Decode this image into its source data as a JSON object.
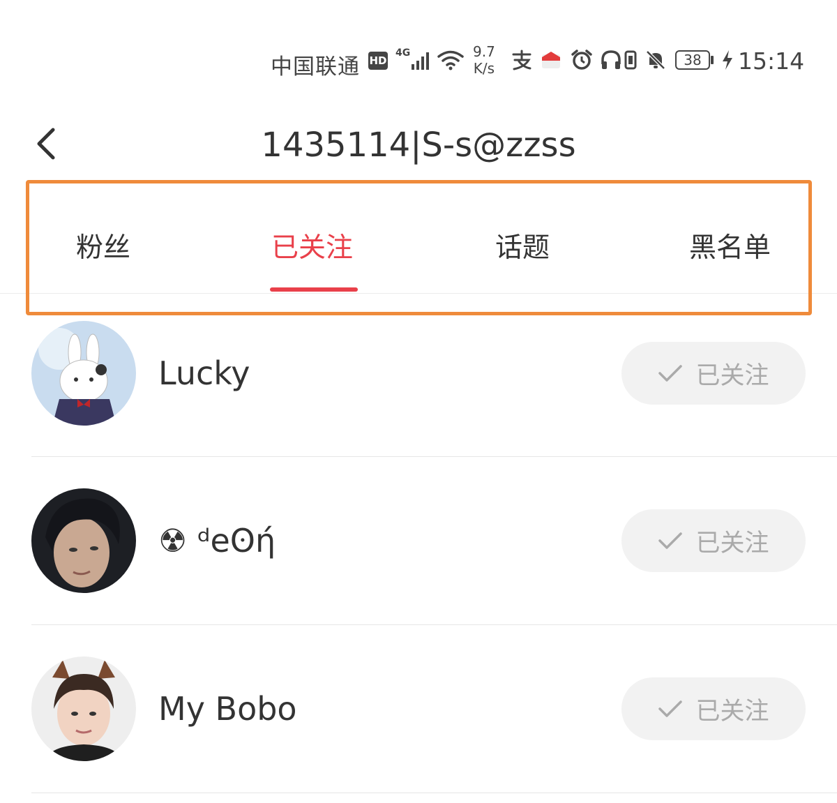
{
  "status_bar": {
    "carrier": "中国联通",
    "hd_badge": "HD",
    "network_type": "4G",
    "speed_value": "9.7",
    "speed_unit": "K/s",
    "battery_level": "38",
    "time": "15:14"
  },
  "header": {
    "title": "1435114|S-s@zzss"
  },
  "tabs": [
    {
      "label": "粉丝",
      "active": false
    },
    {
      "label": "已关注",
      "active": true
    },
    {
      "label": "话题",
      "active": false
    },
    {
      "label": "黑名单",
      "active": false
    }
  ],
  "follow_list": [
    {
      "name": "Lucky",
      "button_label": "已关注"
    },
    {
      "name": "☢ ᵈeʘή",
      "button_label": "已关注"
    },
    {
      "name": "My Bobo",
      "button_label": "已关注"
    }
  ],
  "colors": {
    "accent": "#e9404a",
    "highlight": "#ef8b3b",
    "button_bg": "#f2f2f2"
  }
}
